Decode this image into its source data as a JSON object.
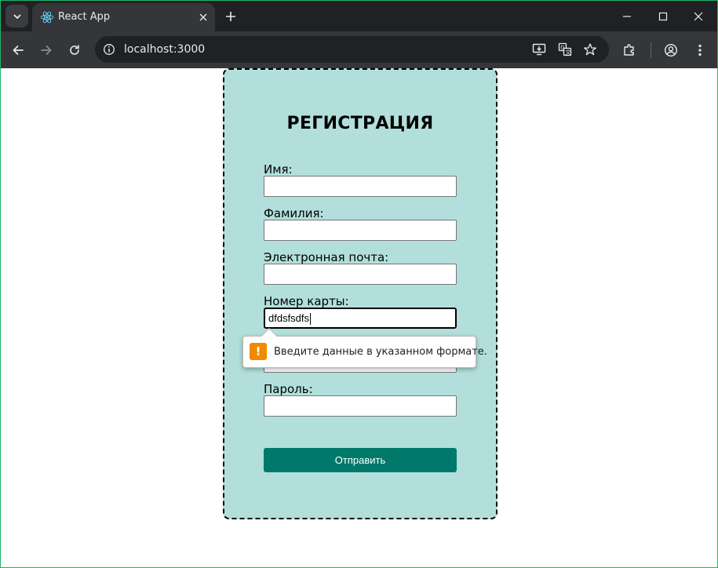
{
  "browser": {
    "tab": {
      "title": "React App"
    },
    "address_bar": {
      "url": "localhost:3000"
    }
  },
  "form": {
    "title": "РЕГИСТРАЦИЯ",
    "fields": [
      {
        "label": "Имя:",
        "value": ""
      },
      {
        "label": "Фамилия:",
        "value": ""
      },
      {
        "label": "Электронная почта:",
        "value": ""
      },
      {
        "label": "Номер карты:",
        "value": "dfdsfsdfs"
      },
      {
        "label": "",
        "value": ""
      },
      {
        "label": "Пароль:",
        "value": ""
      }
    ],
    "submit_label": "Отправить"
  },
  "validation": {
    "message": "Введите данные в указанном формате.",
    "icon": "warning-icon"
  },
  "colors": {
    "form_background": "#b2dfdb",
    "submit_button": "#00796b",
    "warning": "#f18a00",
    "browser_chrome": "#202124"
  }
}
